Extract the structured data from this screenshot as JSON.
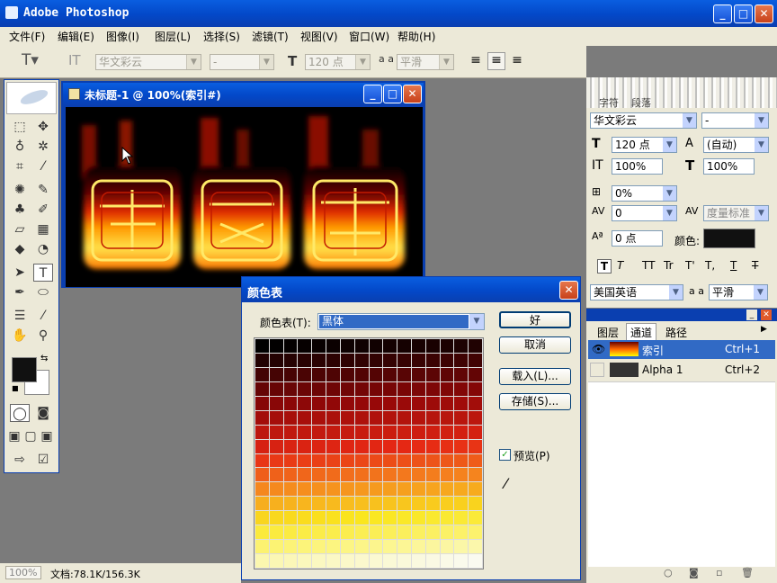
{
  "app": {
    "title": "Adobe Photoshop"
  },
  "menu": [
    "文件(F)",
    "编辑(E)",
    "图像(I)",
    "图层(L)",
    "选择(S)",
    "滤镜(T)",
    "视图(V)",
    "窗口(W)",
    "帮助(H)"
  ],
  "options": {
    "font_family": "华文彩云",
    "font_style": "-",
    "font_size": "120 点",
    "aa_label": "a a",
    "aa_value": "平滑"
  },
  "document": {
    "title": "未标题-1 @ 100%(索引#)"
  },
  "status": {
    "zoom": "100%",
    "doc_size": "文档:78.1K/156.3K"
  },
  "dialog": {
    "title": "颜色表",
    "table_label": "颜色表(T):",
    "table_value": "黑体",
    "ok": "好",
    "cancel": "取消",
    "load": "载入(L)...",
    "save": "存储(S)...",
    "preview": "预览(P)"
  },
  "character_panel": {
    "tab_character": "字符",
    "tab_paragraph": "段落",
    "font_family": "华文彩云",
    "font_style": "-",
    "size": "120 点",
    "leading": "(自动)",
    "vscale": "100%",
    "hscale": "100%",
    "tracking_sel": "0%",
    "tracking": "0",
    "kerning": "度量标准",
    "baseline": "0 点",
    "color_label": "颜色:",
    "language": "美国英语",
    "aa_label": "a a",
    "aa": "平滑",
    "style_buttons": [
      "T",
      "T",
      "TT",
      "Tr",
      "T'",
      "T,",
      "T",
      "T"
    ]
  },
  "layers_panel": {
    "tabs": [
      "图层",
      "通道",
      "路径"
    ],
    "channels": [
      {
        "name": "索引",
        "shortcut": "Ctrl+1"
      },
      {
        "name": "Alpha 1",
        "shortcut": "Ctrl+2"
      }
    ]
  },
  "colors": {
    "titlebar": "#0348c8",
    "chrome": "#ece9d8",
    "selection": "#316ac5"
  }
}
